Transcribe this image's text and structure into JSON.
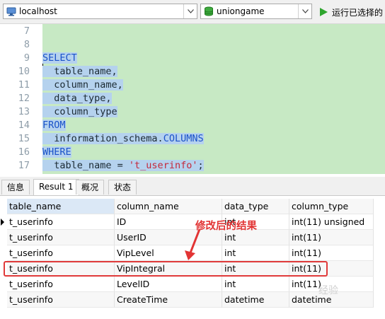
{
  "toolbar": {
    "connection": "localhost",
    "database": "uniongame",
    "run_label": "运行已选择的"
  },
  "editor": {
    "lines": [
      {
        "num": "7",
        "text": ""
      },
      {
        "num": "8",
        "text": ""
      },
      {
        "num": "9",
        "text": "SELECT"
      },
      {
        "num": "10",
        "text": "  table_name,"
      },
      {
        "num": "11",
        "text": "  column_name,"
      },
      {
        "num": "12",
        "text": "  data_type,"
      },
      {
        "num": "13",
        "text": "  column_type"
      },
      {
        "num": "14",
        "text": "FROM"
      },
      {
        "num": "15",
        "text": "  information_schema.COLUMNS"
      },
      {
        "num": "16",
        "text": "WHERE"
      },
      {
        "num": "17",
        "text": "  table_name = 't_userinfo';"
      }
    ]
  },
  "tabs": [
    "信息",
    "Result 1",
    "概况",
    "状态"
  ],
  "grid": {
    "columns": [
      "table_name",
      "column_name",
      "data_type",
      "column_type"
    ],
    "rows": [
      [
        "t_userinfo",
        "ID",
        "int",
        "int(11) unsigned"
      ],
      [
        "t_userinfo",
        "UserID",
        "int",
        "int(11)"
      ],
      [
        "t_userinfo",
        "VipLevel",
        "int",
        "int(11)"
      ],
      [
        "t_userinfo",
        "VipIntegral",
        "int",
        "int(11)"
      ],
      [
        "t_userinfo",
        "LevelID",
        "int",
        "int(11)"
      ],
      [
        "t_userinfo",
        "CreateTime",
        "datetime",
        "datetime"
      ]
    ]
  },
  "annotation": "修改后的结果",
  "watermark": "经验"
}
